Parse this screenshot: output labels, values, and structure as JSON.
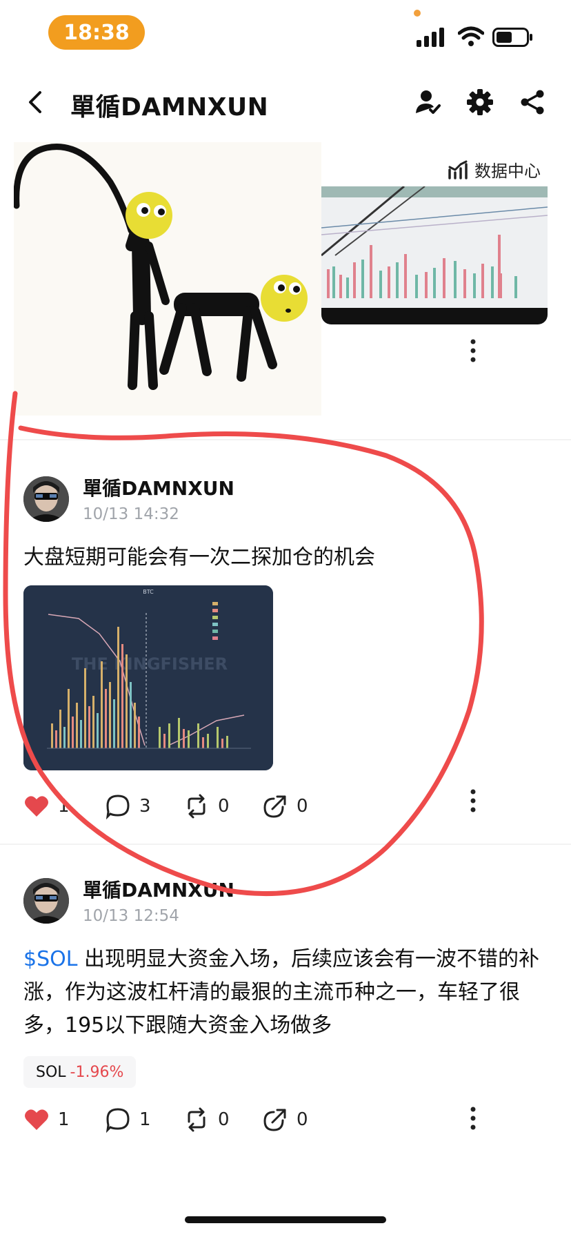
{
  "status_bar": {
    "time": "18:38"
  },
  "header": {
    "title": "單循DAMNXUN"
  },
  "previous_post": {
    "data_center_label": "数据中心"
  },
  "posts": [
    {
      "author": "單循DAMNXUN",
      "time": "10/13 14:32",
      "text": "大盘短期可能会有一次二探加仓的机会",
      "image_title": "BTC",
      "image_watermark": "THE KINGFISHER",
      "likes": "1",
      "comments": "3",
      "reposts": "0",
      "shares": "0"
    },
    {
      "author": "單循DAMNXUN",
      "time": "10/13 12:54",
      "text_ticker": "$SOL",
      "text_body": " 出现明显大资金入场，后续应该会有一波不错的补涨，作为这波杠杆清的最狠的主流币种之一，车轻了很多，195以下跟随大资金入场做多",
      "chip_symbol": "SOL",
      "chip_change": "-1.96%",
      "likes": "1",
      "comments": "1",
      "reposts": "0",
      "shares": "0"
    }
  ],
  "colors": {
    "accent_orange": "#f29d1f",
    "like_red": "#e5484d",
    "link_blue": "#1a73e8",
    "annotation_red": "#ee4b4b"
  }
}
